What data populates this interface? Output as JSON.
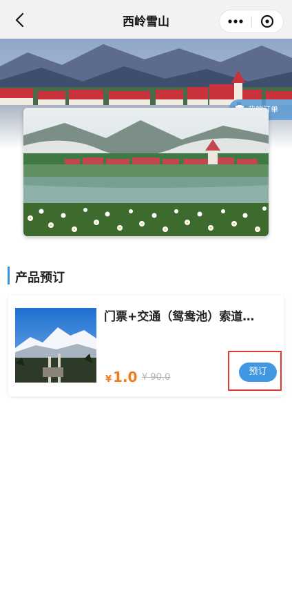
{
  "nav": {
    "title": "西岭雪山",
    "back_icon": "chevron-left-icon",
    "more_icon": "more-dots-icon",
    "close_icon": "close-circle-icon"
  },
  "banner": {
    "order_label": "我的订单",
    "order_icon": "clipboard-icon"
  },
  "section": {
    "title": "产品预订",
    "accent_color": "#3f90dd"
  },
  "products": [
    {
      "name": "门票+交通（鸳鸯池）索道…",
      "currency": "¥",
      "price": "1.0",
      "original_price": "¥ 90.0",
      "book_label": "预订"
    }
  ],
  "colors": {
    "price": "#f07c1a",
    "button": "#4099e0",
    "highlight": "#e03a2e"
  }
}
